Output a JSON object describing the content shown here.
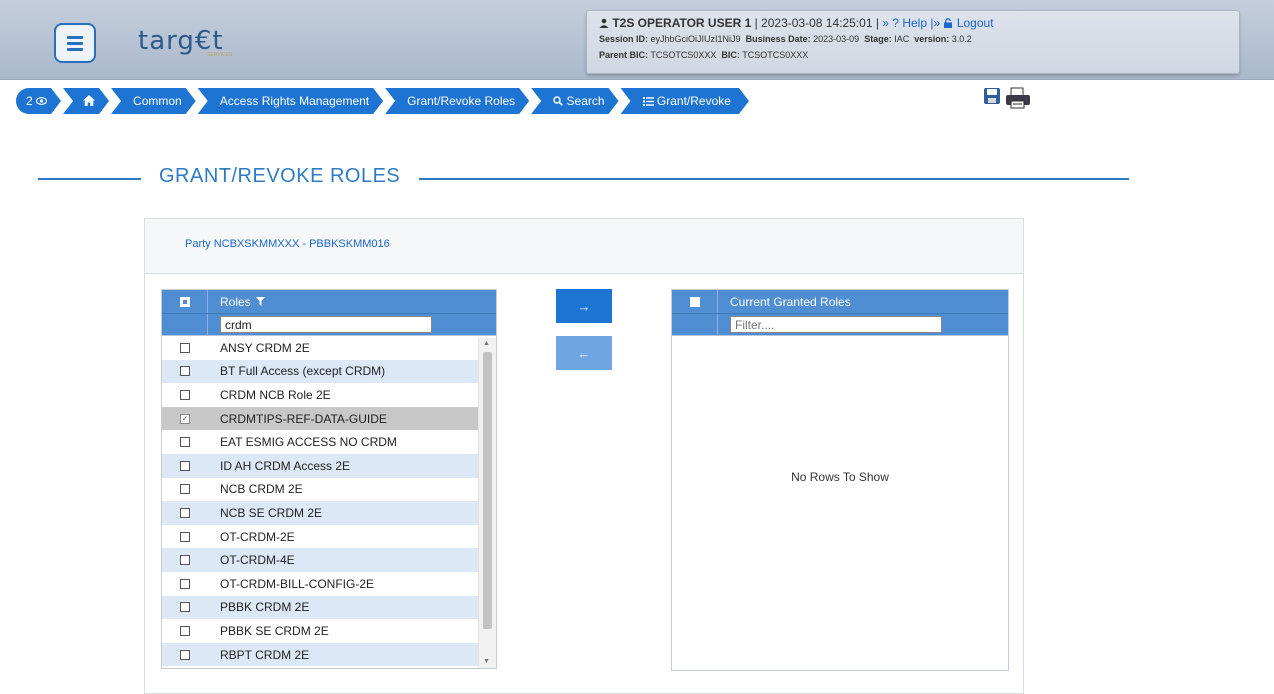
{
  "header": {
    "logo_text": "targ€t",
    "logo_sub": "SERVICES",
    "session": {
      "user": "T2S OPERATOR USER 1",
      "datetime": "| 2023-03-08 14:25:01 |",
      "help": "» ? Help",
      "logout_sep": "|»",
      "logout": "Logout",
      "session_label": "Session ID:",
      "session_id": "eyJhbGciOiJIUzI1NiJ9",
      "business_date_label": "Business Date:",
      "business_date": "2023-03-09",
      "stage_label": "Stage:",
      "stage": "IAC",
      "version_label": "version:",
      "version": "3.0.2",
      "parent_bic_label": "Parent BIC:",
      "parent_bic": "TCSOTCS0XXX",
      "bic_label": "BIC:",
      "bic": "TCSOTCS0XXX"
    }
  },
  "breadcrumb": {
    "counter": "2",
    "items": [
      "Common",
      "Access Rights Management",
      "Grant/Revoke Roles",
      "Search",
      "Grant/Revoke"
    ]
  },
  "page": {
    "title": "GRANT/REVOKE ROLES",
    "party": "Party NCBXSKMMXXX - PBBKSKMM016"
  },
  "left_grid": {
    "header": "Roles",
    "filter_value": "crdm",
    "rows": [
      {
        "name": "ANSY CRDM 2E",
        "checked": false
      },
      {
        "name": "BT Full Access (except CRDM)",
        "checked": false
      },
      {
        "name": "CRDM NCB Role 2E",
        "checked": false
      },
      {
        "name": "CRDMTIPS-REF-DATA-GUIDE",
        "checked": true
      },
      {
        "name": "EAT ESMIG ACCESS NO CRDM",
        "checked": false
      },
      {
        "name": "ID AH CRDM Access 2E",
        "checked": false
      },
      {
        "name": "NCB CRDM 2E",
        "checked": false
      },
      {
        "name": "NCB SE CRDM 2E",
        "checked": false
      },
      {
        "name": "OT-CRDM-2E",
        "checked": false
      },
      {
        "name": "OT-CRDM-4E",
        "checked": false
      },
      {
        "name": "OT-CRDM-BILL-CONFIG-2E",
        "checked": false
      },
      {
        "name": "PBBK CRDM 2E",
        "checked": false
      },
      {
        "name": "PBBK SE CRDM 2E",
        "checked": false
      },
      {
        "name": "RBPT CRDM 2E",
        "checked": false
      }
    ]
  },
  "buttons": {
    "grant": "→",
    "revoke": "←"
  },
  "right_grid": {
    "header": "Current Granted Roles",
    "filter_placeholder": "Filter....",
    "empty_text": "No Rows To Show"
  }
}
